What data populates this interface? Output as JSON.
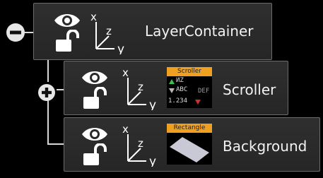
{
  "tree": {
    "root": {
      "label": "LayerContainer",
      "toggle": "collapse",
      "icons": [
        "visibility-eye-icon",
        "unlock-icon",
        "xyz-axes-icon"
      ]
    },
    "children": [
      {
        "label": "Scroller",
        "toggle": "expand",
        "thumbnail": {
          "caption": "Scroller",
          "lines": [
            "ИZ",
            "ABC",
            "DEF",
            "1.234"
          ]
        }
      },
      {
        "label": "Background",
        "thumbnail": {
          "caption": "Rectangle"
        }
      }
    ],
    "axes": {
      "x": "x",
      "y": "y",
      "z": "z"
    }
  },
  "colors": {
    "background": "#000000",
    "node_fill": "#2a2a2a",
    "node_border": "#6c6c6c",
    "icon": "#ffffff",
    "thumb_caption": "#f0a020"
  }
}
